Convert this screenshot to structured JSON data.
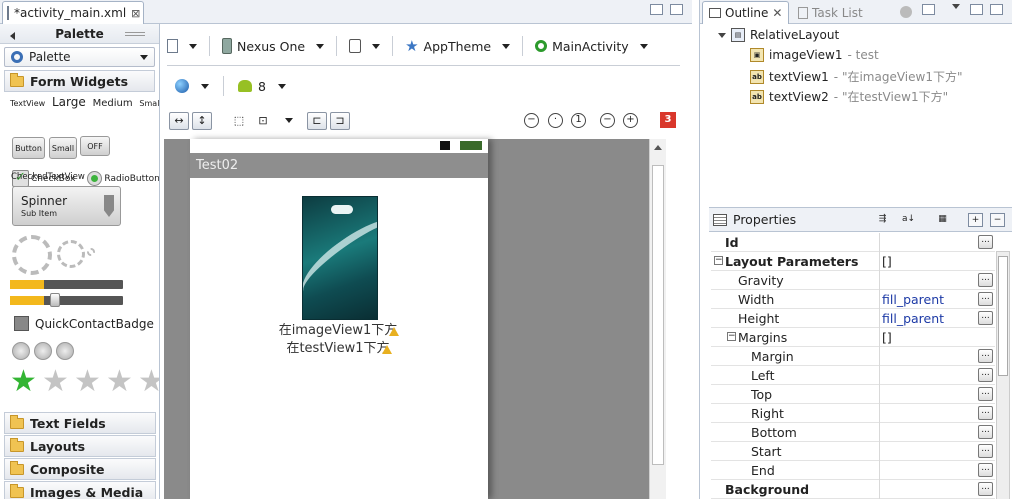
{
  "editor": {
    "tab_label": "*activity_main.xml",
    "tab_close": "⊠"
  },
  "palette": {
    "title": "Palette",
    "combo_label": "Palette",
    "categories": [
      "Form Widgets",
      "Text Fields",
      "Layouts",
      "Composite",
      "Images & Media"
    ],
    "text_sizes": [
      "TextView",
      "Large",
      "Medium",
      "Small"
    ],
    "buttons": [
      "Button",
      "Small",
      "OFF"
    ],
    "checkbox_label": "CheckBox",
    "radio_label": "RadioButton",
    "checked_text_label": "CheckedTextView",
    "spinner_title": "Spinner",
    "spinner_sub": "Sub Item",
    "quick_contact_label": "QuickContactBadge",
    "rating_filled": 1,
    "rating_total": 5,
    "progress_fraction": 0.3
  },
  "toolbar": {
    "device": "Nexus One",
    "theme": "AppTheme",
    "activity": "MainActivity",
    "api_level": "8",
    "error_count": "3"
  },
  "device": {
    "app_title": "Test02",
    "text1": "在imageView1下方",
    "text2": "在testView1下方"
  },
  "outline": {
    "tab_active": "Outline",
    "tab_other": "Task List",
    "root": "RelativeLayout",
    "children": [
      {
        "name": "imageView1",
        "detail": " - test"
      },
      {
        "name": "textView1",
        "detail": " - \"在imageView1下方\""
      },
      {
        "name": "textView2",
        "detail": " - \"在testView1下方\""
      }
    ]
  },
  "properties": {
    "title": "Properties",
    "rows": [
      {
        "name": "Id",
        "value": ""
      },
      {
        "name": "Layout Parameters",
        "value": "[]"
      },
      {
        "name": "Gravity",
        "value": ""
      },
      {
        "name": "Width",
        "value": "fill_parent"
      },
      {
        "name": "Height",
        "value": "fill_parent"
      },
      {
        "name": "Margins",
        "value": "[]"
      },
      {
        "name": "Margin",
        "value": ""
      },
      {
        "name": "Left",
        "value": ""
      },
      {
        "name": "Top",
        "value": ""
      },
      {
        "name": "Right",
        "value": ""
      },
      {
        "name": "Bottom",
        "value": ""
      },
      {
        "name": "Start",
        "value": ""
      },
      {
        "name": "End",
        "value": ""
      },
      {
        "name": "Background",
        "value": ""
      }
    ]
  },
  "colors": {
    "accent": "#3b6fb5",
    "error": "#d9372b",
    "star_on": "#33b533"
  }
}
